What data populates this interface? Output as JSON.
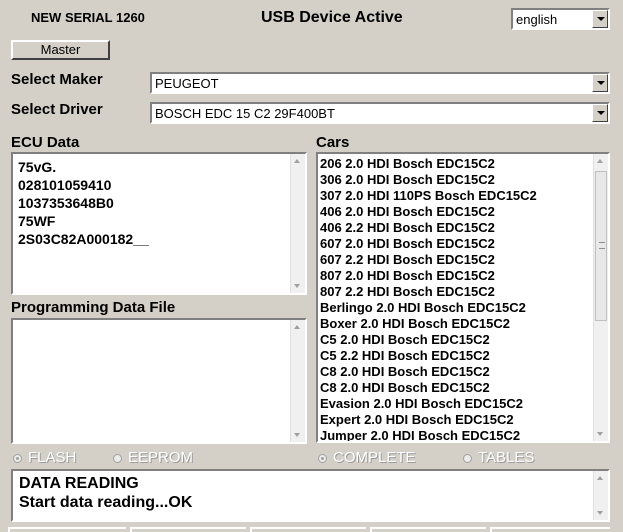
{
  "header": {
    "serial": "NEW SERIAL 1260",
    "usb_status": "USB Device Active",
    "language": "english"
  },
  "master_button": "Master",
  "maker": {
    "label": "Select Maker",
    "value": "PEUGEOT"
  },
  "driver": {
    "label": "Select Driver",
    "value": "BOSCH EDC 15 C2 29F400BT"
  },
  "ecu": {
    "label": "ECU Data",
    "lines": [
      "75vG.",
      "028101059410",
      "1037353648B0",
      "75WF",
      "2S03C82A000182__"
    ]
  },
  "programming": {
    "label": "Programming Data File"
  },
  "cars": {
    "label": "Cars",
    "items": [
      "206 2.0 HDI Bosch EDC15C2",
      "306 2.0 HDI Bosch EDC15C2",
      "307 2.0 HDI 110PS Bosch EDC15C2",
      "406 2.0 HDI Bosch EDC15C2",
      "406 2.2 HDI Bosch EDC15C2",
      "607 2.0 HDI Bosch EDC15C2",
      "607 2.2 HDI Bosch EDC15C2",
      "807 2.0 HDI Bosch EDC15C2",
      "807 2.2 HDI Bosch EDC15C2",
      "Berlingo 2.0 HDI Bosch EDC15C2",
      "Boxer 2.0 HDI Bosch EDC15C2",
      "C5 2.0 HDI Bosch EDC15C2",
      "C5 2.2 HDI Bosch EDC15C2",
      "C8 2.0 HDI Bosch EDC15C2",
      "C8 2.0 HDI Bosch EDC15C2",
      "Evasion 2.0 HDI Bosch EDC15C2",
      "Expert 2.0 HDI Bosch EDC15C2",
      "Jumper 2.0 HDI Bosch EDC15C2"
    ]
  },
  "mode_options": {
    "flash": "FLASH",
    "eeprom": "EEPROM",
    "complete": "COMPLETE",
    "tables": "TABLES"
  },
  "status": {
    "lines": [
      "DATA READING",
      "Start data reading...OK"
    ]
  },
  "icons": {
    "dropdown": "chevron-down-icon",
    "scroll_up": "scroll-up-arrow-icon",
    "scroll_down": "scroll-down-arrow-icon",
    "grip": "scroll-grip-icon",
    "radio": "radio-icon"
  }
}
